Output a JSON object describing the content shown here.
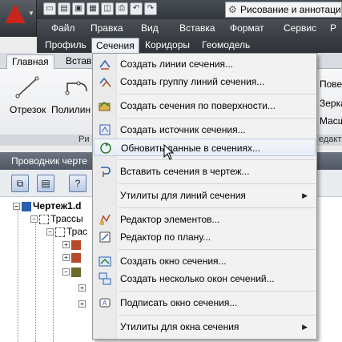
{
  "menubar": {
    "row1": [
      "Файл",
      "Правка",
      "Вид",
      "Вставка",
      "Формат",
      "Сервис",
      "Р"
    ],
    "row2": [
      "Профиль",
      "Сечения",
      "Коридоры",
      "Геомодель"
    ],
    "active": "Сечения"
  },
  "workspace": {
    "label": "Рисование и аннотации"
  },
  "ribbon": {
    "tabs": [
      "Главная",
      "Встав"
    ],
    "tools": [
      "Отрезок",
      "Полилин"
    ],
    "panel_footer_left": "Ри",
    "panel_footer_right": "едакт",
    "right_labels": [
      "Повер",
      "Зерка",
      "Масш"
    ]
  },
  "palette": {
    "title": "Проводник черте",
    "tree": [
      "Чертеж1.d",
      "Трассы",
      "Трас"
    ]
  },
  "dropdown": {
    "items": [
      {
        "label": "Создать линии сечения...",
        "icon": "section-line-icon"
      },
      {
        "label": "Создать группу линий сечения...",
        "icon": "section-group-icon"
      },
      {
        "label": "Создать сечения по поверхности...",
        "icon": "surface-section-icon"
      },
      {
        "label": "Создать источник сечения...",
        "icon": "section-source-icon"
      },
      {
        "label": "Обновить данные в сечениях...",
        "icon": "update-sections-icon"
      },
      {
        "label": "Вставить сечения в чертеж...",
        "icon": "insert-sections-icon"
      },
      {
        "label": "Утилиты для линий сечения",
        "icon": "none"
      },
      {
        "label": "Редактор элементов...",
        "icon": "element-editor-icon"
      },
      {
        "label": "Редактор по плану...",
        "icon": "plan-editor-icon"
      },
      {
        "label": "Создать окно сечения...",
        "icon": "section-view-icon"
      },
      {
        "label": "Создать несколько окон сечений...",
        "icon": "multiple-views-icon"
      },
      {
        "label": "Подписать окно сечения...",
        "icon": "label-view-icon"
      },
      {
        "label": "Утилиты для окна сечения",
        "icon": "none"
      }
    ],
    "hovered": "Обновить данные в сечениях..."
  },
  "colors": {
    "titlebar": "#3a3e44",
    "menu_bg": "#f2f2f2",
    "hover_border": "#b8c8dc",
    "accent_red": "#c8261d"
  }
}
